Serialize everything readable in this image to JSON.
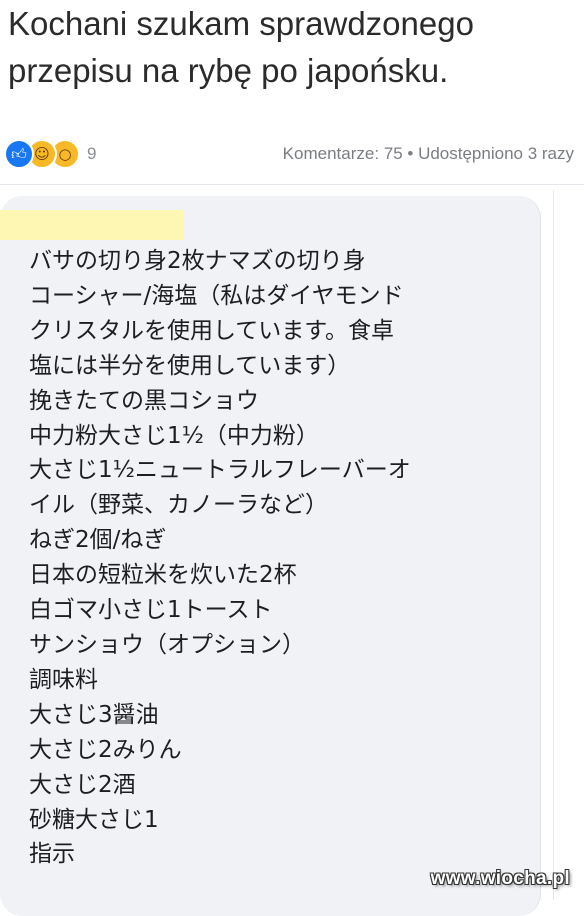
{
  "post": {
    "text_lines": [
      "Kochani szukam sprawdzonego",
      "przepisu na rybę po japońsku."
    ]
  },
  "reactions": {
    "icons": [
      "like-icon",
      "haha-icon",
      "wow-icon"
    ],
    "count": "9",
    "stats": "Komentarze: 75 • Udostępniono 3 razy"
  },
  "comment": {
    "lines": [
      "バサの切り身2枚ナマズの切り身",
      "コーシャー/海塩（私はダイヤモンド",
      "クリスタルを使用しています。食卓",
      "塩には半分を使用しています）",
      "挽きたての黒コショウ",
      "中力粉大さじ1½（中力粉）",
      "大さじ1½ニュートラルフレーバーオ",
      "イル（野菜、カノーラなど）",
      "ねぎ2個/ねぎ",
      "日本の短粒米を炊いた2杯",
      "白ゴマ小さじ1トースト",
      "サンショウ（オプション）",
      "調味料",
      "大さじ3醤油",
      "大さじ2みりん",
      "大さじ2酒",
      "砂糖大さじ1",
      "指示"
    ]
  },
  "watermark": "www.wiocha.pl",
  "colors": {
    "like_blue": "#1877f2",
    "emoji_yellow": "#f7b928",
    "bubble_bg": "#f0f2f5",
    "redaction_yellow": "#fdf7b3"
  }
}
